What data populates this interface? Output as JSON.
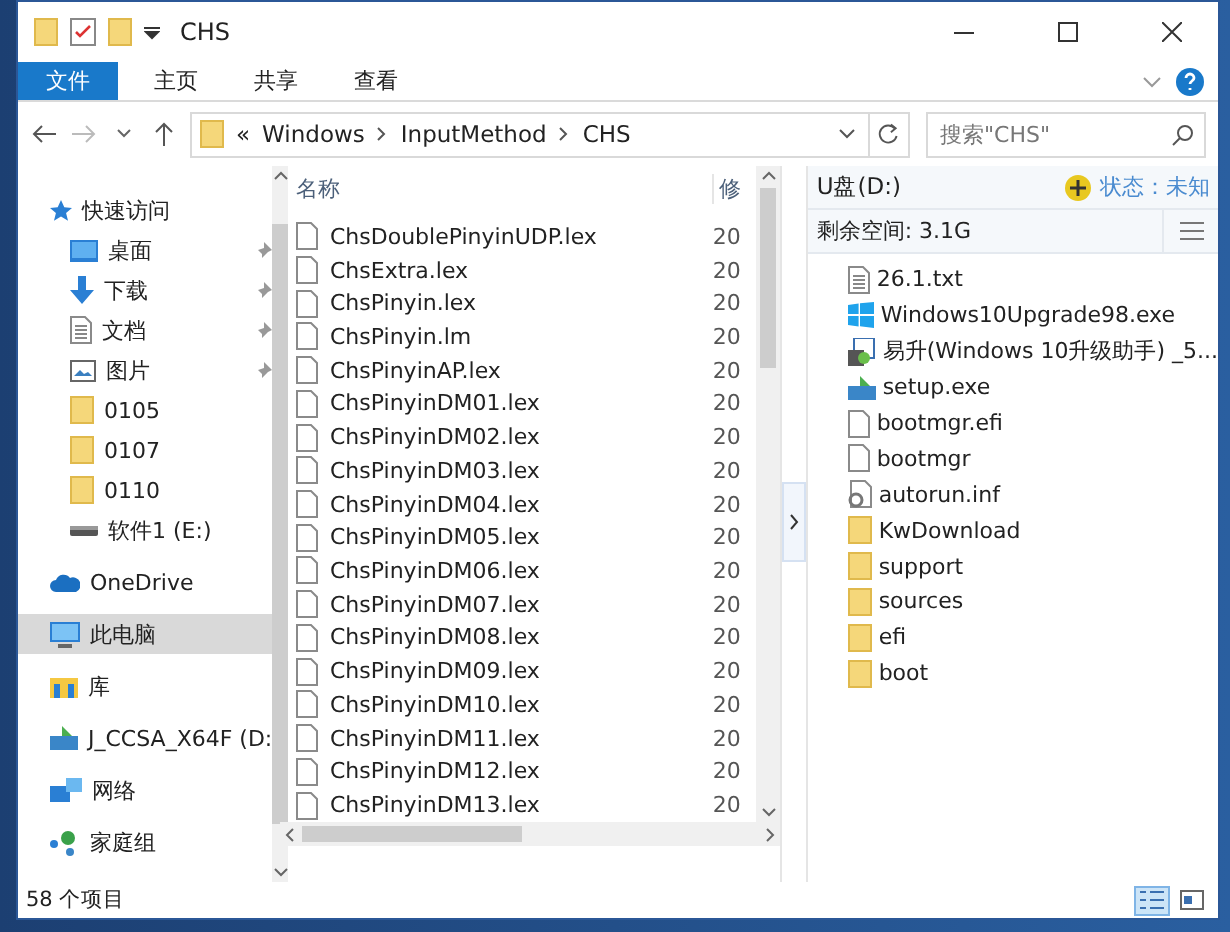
{
  "window": {
    "title": "CHS"
  },
  "ribbon": {
    "tabs": [
      {
        "label": "文件",
        "selected": true
      },
      {
        "label": "主页",
        "selected": false
      },
      {
        "label": "共享",
        "selected": false
      },
      {
        "label": "查看",
        "selected": false
      }
    ]
  },
  "address": {
    "overflow": "«",
    "path": [
      "Windows",
      "InputMethod",
      "CHS"
    ],
    "search": {
      "placeholder": "搜索\"CHS\""
    }
  },
  "sidebar": {
    "items": [
      {
        "kind": "star",
        "label": "快速访问",
        "pinned": false,
        "selected": false,
        "group": false
      },
      {
        "kind": "desktop",
        "label": "桌面",
        "pinned": true,
        "selected": false,
        "group": false
      },
      {
        "kind": "download",
        "label": "下载",
        "pinned": true,
        "selected": false,
        "group": false
      },
      {
        "kind": "document",
        "label": "文档",
        "pinned": true,
        "selected": false,
        "group": false
      },
      {
        "kind": "picture",
        "label": "图片",
        "pinned": true,
        "selected": false,
        "group": false
      },
      {
        "kind": "folder",
        "label": "0105",
        "pinned": false,
        "selected": false,
        "group": false
      },
      {
        "kind": "folder",
        "label": "0107",
        "pinned": false,
        "selected": false,
        "group": false
      },
      {
        "kind": "folder",
        "label": "0110",
        "pinned": false,
        "selected": false,
        "group": false
      },
      {
        "kind": "drive",
        "label": "软件1 (E:)",
        "pinned": false,
        "selected": false,
        "group": false
      },
      {
        "kind": "cloud",
        "label": "OneDrive",
        "pinned": false,
        "selected": false,
        "group": true
      },
      {
        "kind": "pc",
        "label": "此电脑",
        "pinned": false,
        "selected": true,
        "group": true
      },
      {
        "kind": "library",
        "label": "库",
        "pinned": false,
        "selected": false,
        "group": true
      },
      {
        "kind": "usb",
        "label": "J_CCSA_X64F (D:",
        "pinned": false,
        "selected": false,
        "group": true
      },
      {
        "kind": "network",
        "label": "网络",
        "pinned": false,
        "selected": false,
        "group": true
      },
      {
        "kind": "homegroup",
        "label": "家庭组",
        "pinned": false,
        "selected": false,
        "group": true
      }
    ]
  },
  "table": {
    "columns": [
      "名称",
      "修"
    ],
    "rows": [
      {
        "name": "ChsDoublePinyinUDP.lex",
        "date": "20"
      },
      {
        "name": "ChsExtra.lex",
        "date": "20"
      },
      {
        "name": "ChsPinyin.lex",
        "date": "20"
      },
      {
        "name": "ChsPinyin.lm",
        "date": "20"
      },
      {
        "name": "ChsPinyinAP.lex",
        "date": "20"
      },
      {
        "name": "ChsPinyinDM01.lex",
        "date": "20"
      },
      {
        "name": "ChsPinyinDM02.lex",
        "date": "20"
      },
      {
        "name": "ChsPinyinDM03.lex",
        "date": "20"
      },
      {
        "name": "ChsPinyinDM04.lex",
        "date": "20"
      },
      {
        "name": "ChsPinyinDM05.lex",
        "date": "20"
      },
      {
        "name": "ChsPinyinDM06.lex",
        "date": "20"
      },
      {
        "name": "ChsPinyinDM07.lex",
        "date": "20"
      },
      {
        "name": "ChsPinyinDM08.lex",
        "date": "20"
      },
      {
        "name": "ChsPinyinDM09.lex",
        "date": "20"
      },
      {
        "name": "ChsPinyinDM10.lex",
        "date": "20"
      },
      {
        "name": "ChsPinyinDM11.lex",
        "date": "20"
      },
      {
        "name": "ChsPinyinDM12.lex",
        "date": "20"
      },
      {
        "name": "ChsPinyinDM13.lex",
        "date": "20"
      }
    ]
  },
  "usb_panel": {
    "title": "U盘(D:)",
    "status": "状态：未知",
    "free_space": "剩余空间: 3.1G",
    "items": [
      {
        "kind": "text",
        "name": "26.1.txt"
      },
      {
        "kind": "windows",
        "name": "Windows10Upgrade98.exe"
      },
      {
        "kind": "installer",
        "name": "易升(Windows 10升级助手) _5..."
      },
      {
        "kind": "setup",
        "name": "setup.exe"
      },
      {
        "kind": "file",
        "name": "bootmgr.efi"
      },
      {
        "kind": "file",
        "name": "bootmgr"
      },
      {
        "kind": "settings",
        "name": "autorun.inf"
      },
      {
        "kind": "folder",
        "name": "KwDownload"
      },
      {
        "kind": "folder",
        "name": "support"
      },
      {
        "kind": "folder",
        "name": "sources"
      },
      {
        "kind": "folder",
        "name": "efi"
      },
      {
        "kind": "folder",
        "name": "boot"
      }
    ]
  },
  "status_bar": {
    "count": "58 个项目",
    "views": [
      {
        "kind": "details",
        "selected": true
      },
      {
        "kind": "tiles",
        "selected": false
      }
    ]
  }
}
